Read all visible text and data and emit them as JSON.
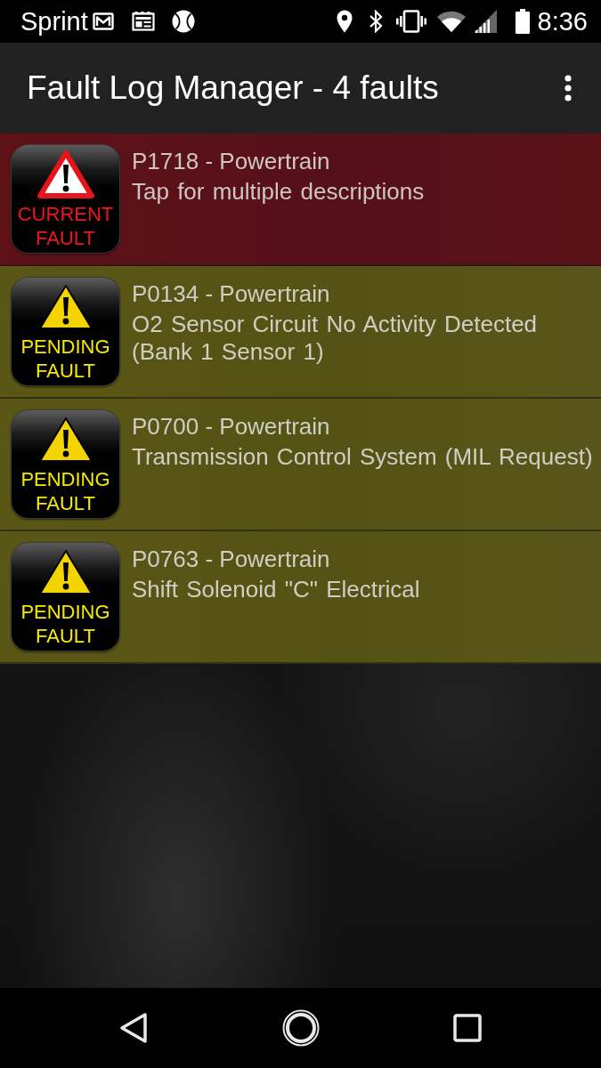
{
  "status_bar": {
    "carrier": "Sprint",
    "time": "8:36"
  },
  "app_bar": {
    "title": "Fault Log Manager - 4 faults"
  },
  "faults": [
    {
      "kind": "current",
      "badge": "CURRENT FAULT",
      "code": "P1718 - Powertrain",
      "description": "Tap for multiple descriptions"
    },
    {
      "kind": "pending",
      "badge": "PENDING FAULT",
      "code": "P0134 - Powertrain",
      "description": "O2 Sensor Circuit No Activity Detected (Bank 1 Sensor 1)"
    },
    {
      "kind": "pending",
      "badge": "PENDING FAULT",
      "code": "P0700 - Powertrain",
      "description": "Transmission Control System (MIL Request)"
    },
    {
      "kind": "pending",
      "badge": "PENDING FAULT",
      "code": "P0763 - Powertrain",
      "description": "Shift Solenoid \"C\" Electrical"
    }
  ]
}
